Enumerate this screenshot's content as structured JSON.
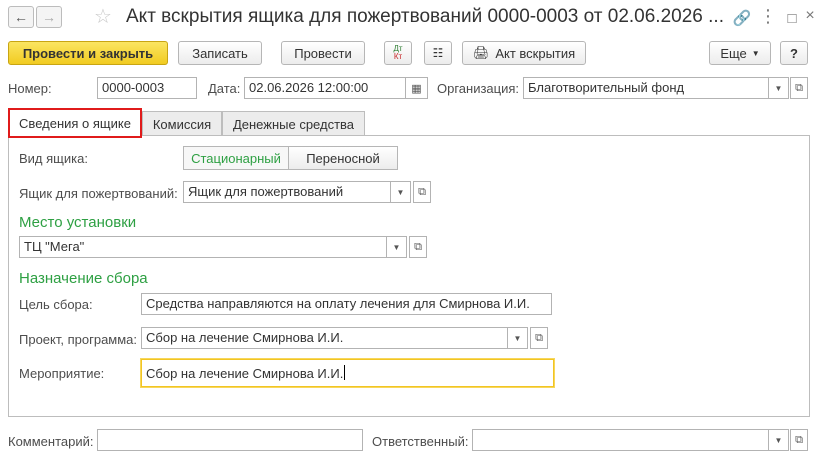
{
  "window": {
    "title": "Акт вскрытия ящика для пожертвований 0000-0003 от 02.06.2026 ..."
  },
  "toolbar": {
    "post_close": "Провести и закрыть",
    "write": "Записать",
    "post": "Провести",
    "dt_kt_top": "Дт",
    "dt_kt_bottom": "Кт",
    "print_label": "Акт вскрытия",
    "more": "Еще",
    "help": "?"
  },
  "header": {
    "number_label": "Номер:",
    "number_value": "0000-0003",
    "date_label": "Дата:",
    "date_value": "02.06.2026 12:00:00",
    "org_label": "Организация:",
    "org_value": "Благотворительный фонд"
  },
  "tabs": [
    {
      "label": "Сведения о ящике"
    },
    {
      "label": "Комиссия"
    },
    {
      "label": "Денежные средства"
    }
  ],
  "box": {
    "kind_label": "Вид ящика:",
    "kind_options": [
      "Стационарный",
      "Переносной"
    ],
    "box_label": "Ящик для пожертвований:",
    "box_value": "Ящик для пожертвований"
  },
  "location": {
    "title": "Место установки",
    "value": "ТЦ \"Мега\""
  },
  "purpose": {
    "title": "Назначение сбора",
    "goal_label": "Цель сбора:",
    "goal_value": "Средства направляются на оплату лечения для Смирнова И.И.",
    "project_label": "Проект, программа:",
    "project_value": "Сбор на лечение Смирнова И.И.",
    "event_label": "Мероприятие:",
    "event_value": "Сбор на лечение Смирнова И.И."
  },
  "footer": {
    "comment_label": "Комментарий:",
    "comment_value": "",
    "responsible_label": "Ответственный:",
    "responsible_value": ""
  },
  "colors": {
    "accent_green": "#2ea043",
    "primary_yellow": "#f1cb21",
    "highlight_red": "#e01b1b"
  }
}
